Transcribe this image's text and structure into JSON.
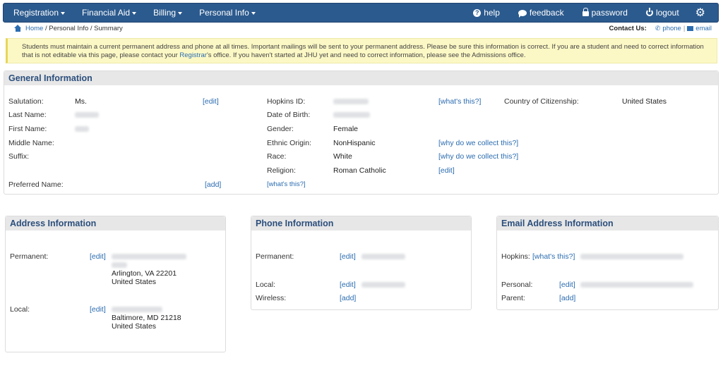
{
  "nav": {
    "menus": [
      {
        "label": "Registration"
      },
      {
        "label": "Financial Aid"
      },
      {
        "label": "Billing"
      },
      {
        "label": "Personal Info"
      }
    ],
    "right": {
      "help": "help",
      "feedback": "feedback",
      "password": "password",
      "logout": "logout"
    }
  },
  "breadcrumb": {
    "home": "Home",
    "rest": "/ Personal Info / Summary"
  },
  "contact": {
    "label": "Contact Us:",
    "phone": "phone",
    "sep": "|",
    "email": "email"
  },
  "alert": {
    "line1": "Students must maintain a current permanent address and phone at all times. Important mailings will be sent to your permanent address. Please be sure this information is correct. If you are a student and need to correct information",
    "line2a": "that is not editable via this page, please contact your ",
    "registrar": "Registrar",
    "line2b": "'s office. If you haven't started at JHU yet and need to correct information, please see the Admissions office."
  },
  "general": {
    "title": "General Information",
    "salutation_label": "Salutation:",
    "salutation_value": "Ms.",
    "last_name_label": "Last Name:",
    "first_name_label": "First Name:",
    "middle_name_label": "Middle Name:",
    "suffix_label": "Suffix:",
    "preferred_name_label": "Preferred Name:",
    "edit": "[edit]",
    "add": "[add]",
    "whats_this": "[what's this?]",
    "hopkins_id_label": "Hopkins ID:",
    "dob_label": "Date of Birth:",
    "gender_label": "Gender:",
    "gender_value": "Female",
    "ethnic_label": "Ethnic Origin:",
    "ethnic_value": "NonHispanic",
    "race_label": "Race:",
    "race_value": "White",
    "religion_label": "Religion:",
    "religion_value": "Roman Catholic",
    "why_collect": "[why do we collect this?]",
    "citizenship_label": "Country of Citizenship:",
    "citizenship_value": "United States"
  },
  "address": {
    "title": "Address Information",
    "permanent_label": "Permanent:",
    "perm_city": "Arlington, VA 22201",
    "perm_country": "United States",
    "local_label": "Local:",
    "local_city": "Baltimore, MD 21218",
    "local_country": "United States",
    "edit": "[edit]"
  },
  "phone": {
    "title": "Phone Information",
    "permanent_label": "Permanent:",
    "local_label": "Local:",
    "wireless_label": "Wireless:",
    "edit": "[edit]",
    "add": "[add]"
  },
  "email": {
    "title": "Email Address Information",
    "hopkins_label": "Hopkins:",
    "personal_label": "Personal:",
    "parent_label": "Parent:",
    "whats_this": "[what's this?]",
    "edit": "[edit]",
    "add": "[add]"
  }
}
